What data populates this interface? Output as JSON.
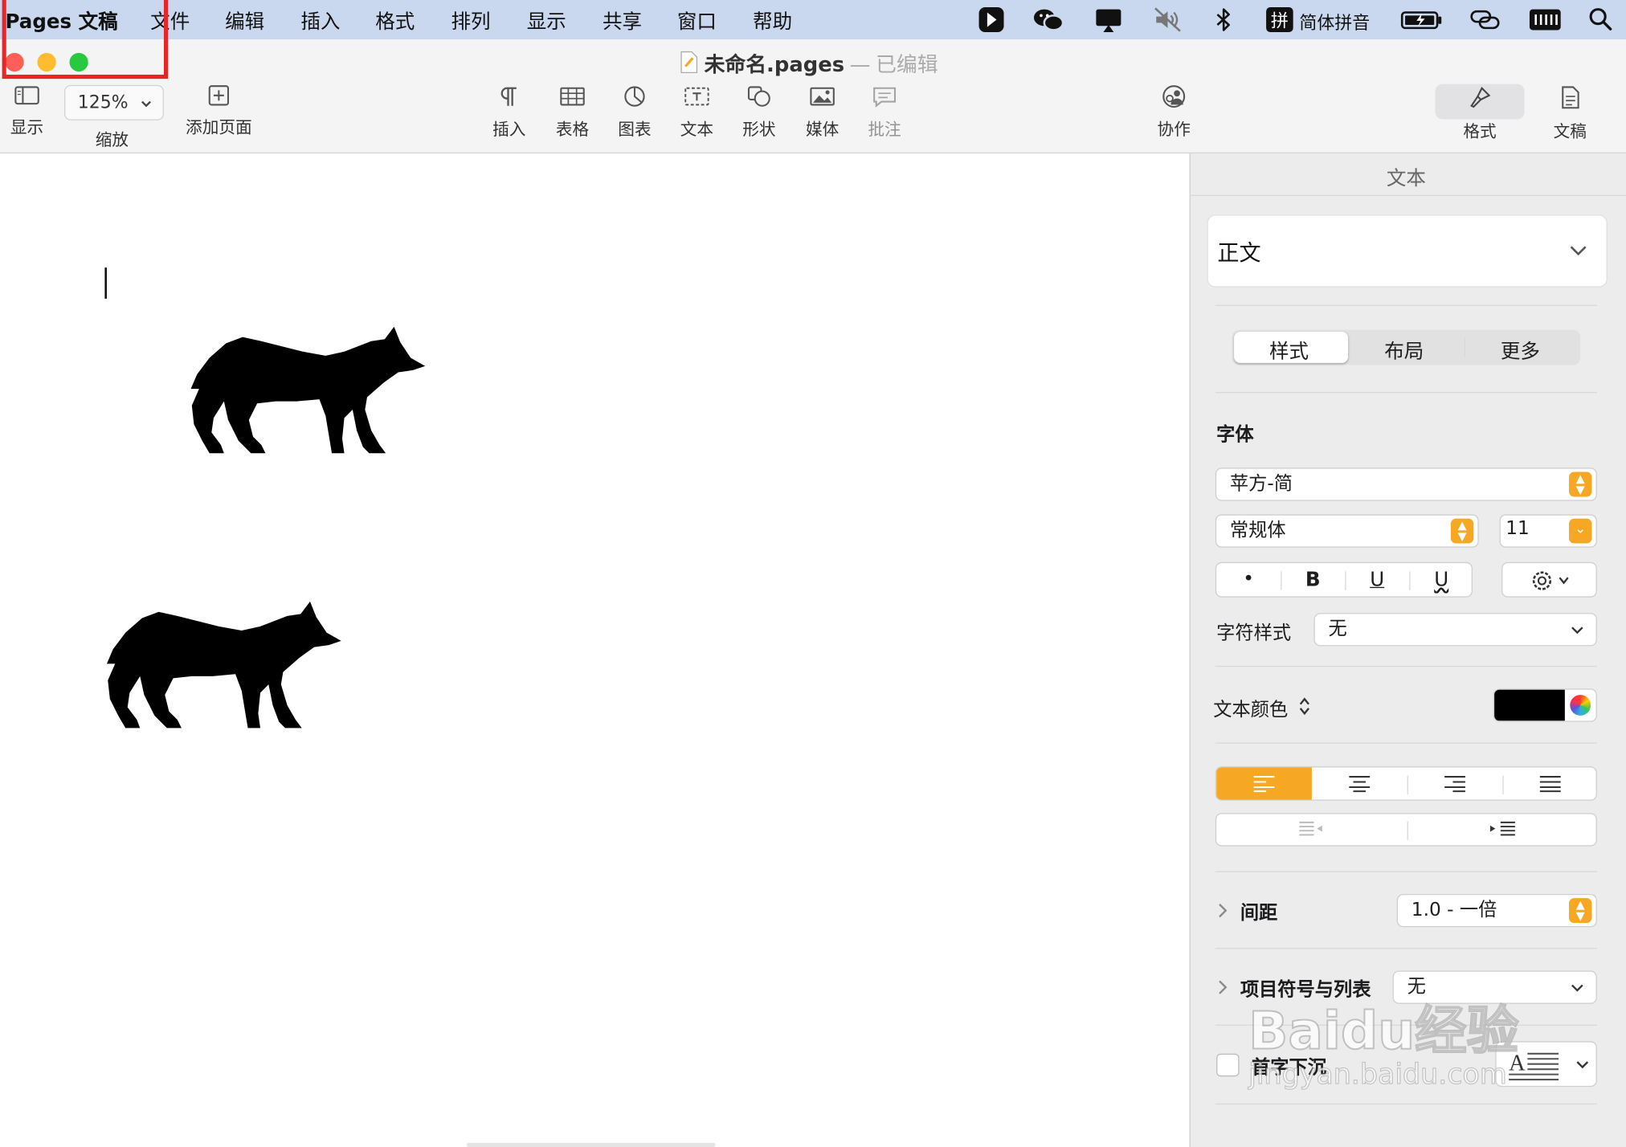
{
  "menubar": {
    "app_name": "Pages 文稿",
    "items": [
      "文件",
      "编辑",
      "插入",
      "格式",
      "排列",
      "显示",
      "共享",
      "窗口",
      "帮助"
    ],
    "input_method": "简体拼音",
    "input_method_glyph": "拼"
  },
  "window": {
    "file_name": "未命名.pages",
    "separator": "—",
    "state": "已编辑"
  },
  "toolbar": {
    "view_label": "显示",
    "zoom_value": "125%",
    "zoom_label": "缩放",
    "add_page_label": "添加页面",
    "insert_label": "插入",
    "table_label": "表格",
    "chart_label": "图表",
    "text_label": "文本",
    "shape_label": "形状",
    "media_label": "媒体",
    "comment_label": "批注",
    "collaborate_label": "协作",
    "format_label": "格式",
    "document_label": "文稿"
  },
  "inspector": {
    "title": "文本",
    "paragraph_style": "正文",
    "tabs": [
      "样式",
      "布局",
      "更多"
    ],
    "font_section": "字体",
    "font_family": "苹方-简",
    "font_typeface": "常规体",
    "font_size": "11",
    "bold_glyph": "B",
    "underline_glyph": "U",
    "char_style_label": "字符样式",
    "char_style_value": "无",
    "text_color_label": "文本颜色",
    "text_color": "#000000",
    "spacing_label": "间距",
    "spacing_value": "1.0 - 一倍",
    "bullets_label": "项目符号与列表",
    "bullets_value": "无",
    "dropcap_label": "首字下沉"
  },
  "colors": {
    "accent": "#f6a825",
    "highlight_box": "#e8262a",
    "close": "#fe5f57",
    "minimize": "#febc2e",
    "zoom": "#28c840"
  },
  "watermark": {
    "line1": "Baidu经验",
    "line2": "jingyan.baidu.com"
  }
}
